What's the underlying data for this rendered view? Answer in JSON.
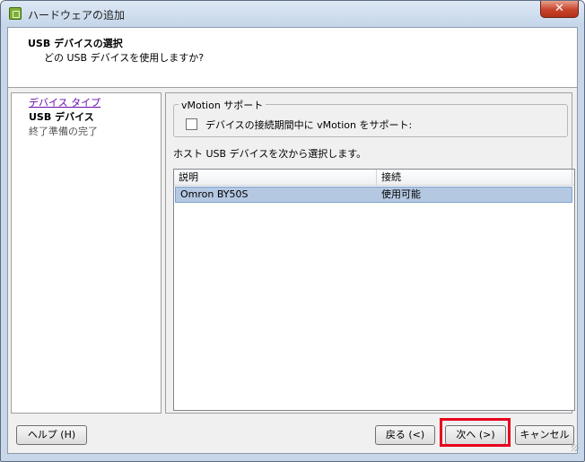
{
  "window": {
    "title": "ハードウェアの追加",
    "close_label": "✕"
  },
  "header": {
    "title": "USB デバイスの選択",
    "subtitle": "どの USB デバイスを使用しますか?"
  },
  "nav": {
    "items": [
      {
        "label": "デバイス タイプ",
        "state": "link"
      },
      {
        "label": "USB デバイス",
        "state": "current"
      },
      {
        "label": "終了準備の完了",
        "state": "future"
      }
    ]
  },
  "vmotion": {
    "group_label": "vMotion サポート",
    "checkbox_label": "デバイスの接続期間中に vMotion をサポート:",
    "checked": false
  },
  "instruction": "ホスト USB デバイスを次から選択します。",
  "device_list": {
    "columns": [
      "説明",
      "接続"
    ],
    "rows": [
      {
        "description": "Omron BY50S",
        "connection": "使用可能",
        "selected": true
      }
    ]
  },
  "buttons": {
    "help": "ヘルプ (H)",
    "back": "戻る (<)",
    "next": "次へ (>)",
    "cancel": "キャンセル"
  },
  "colors": {
    "title_bar": "#c5d6ea",
    "close_button": "#c7432b",
    "selection": "#b5c8e2",
    "highlight_frame": "#e8001c",
    "nav_link": "#6a0dad"
  }
}
